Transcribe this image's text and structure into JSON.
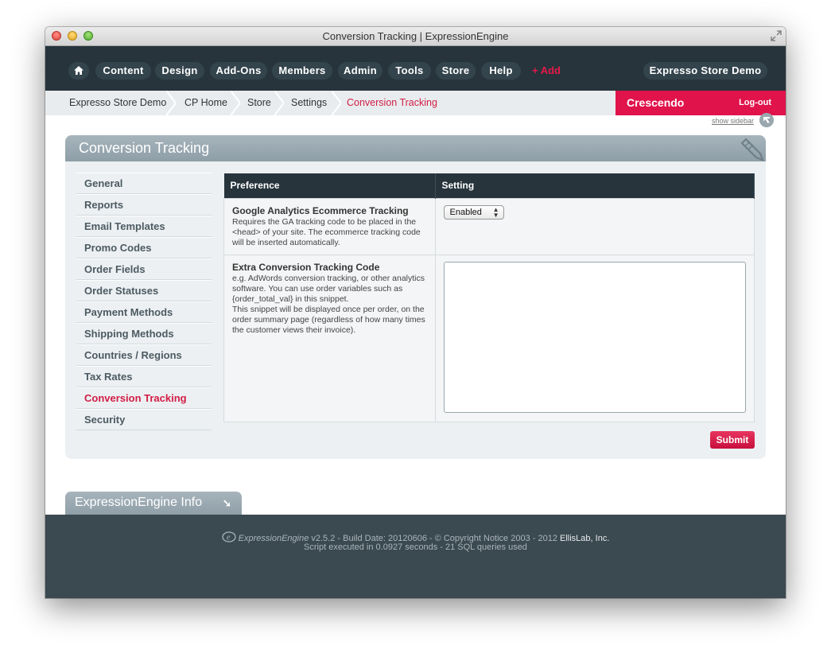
{
  "window": {
    "title": "Conversion Tracking | ExpressionEngine"
  },
  "nav": {
    "items": [
      "Content",
      "Design",
      "Add-Ons",
      "Members",
      "Admin",
      "Tools",
      "Store",
      "Help"
    ],
    "add_label": "+ Add",
    "site_label": "Expresso Store Demo"
  },
  "breadcrumb": [
    "Expresso Store Demo",
    "CP Home",
    "Store",
    "Settings",
    "Conversion Tracking"
  ],
  "user": {
    "name": "Crescendo",
    "logout": "Log-out"
  },
  "show_sidebar": "show sidebar",
  "panel": {
    "title": "Conversion Tracking"
  },
  "side_menu": [
    "General",
    "Reports",
    "Email Templates",
    "Promo Codes",
    "Order Fields",
    "Order Statuses",
    "Payment Methods",
    "Shipping Methods",
    "Countries / Regions",
    "Tax Rates",
    "Conversion Tracking",
    "Security"
  ],
  "table": {
    "headers": {
      "preference": "Preference",
      "setting": "Setting"
    },
    "rows": [
      {
        "name": "Google Analytics Ecommerce Tracking",
        "desc": "Requires the GA tracking code to be placed in the <head> of your site. The ecommerce tracking code will be inserted automatically.",
        "value": "Enabled"
      },
      {
        "name": "Extra Conversion Tracking Code",
        "desc": "e.g. AdWords conversion tracking, or other analytics software. You can use order variables such as {order_total_val} in this snippet.",
        "desc2": "This snippet will be displayed once per order, on the order summary page (regardless of how many times the customer views their invoice).",
        "value": ""
      }
    ]
  },
  "submit_label": "Submit",
  "ee_info": {
    "label": "ExpressionEngine Info",
    "arrow": "➘"
  },
  "footer": {
    "brand": "ExpressionEngine",
    "line1": " v2.5.2 - Build Date: 20120606 - © Copyright Notice 2003 - 2012 ",
    "company": "EllisLab, Inc.",
    "line2": "Script executed in 0.0927 seconds - 21 SQL queries used"
  },
  "colors": {
    "accent": "#e0134b",
    "nav_bg": "#27343c",
    "footer_bg": "#3b4950",
    "panel_head": "#9aa8b0"
  }
}
